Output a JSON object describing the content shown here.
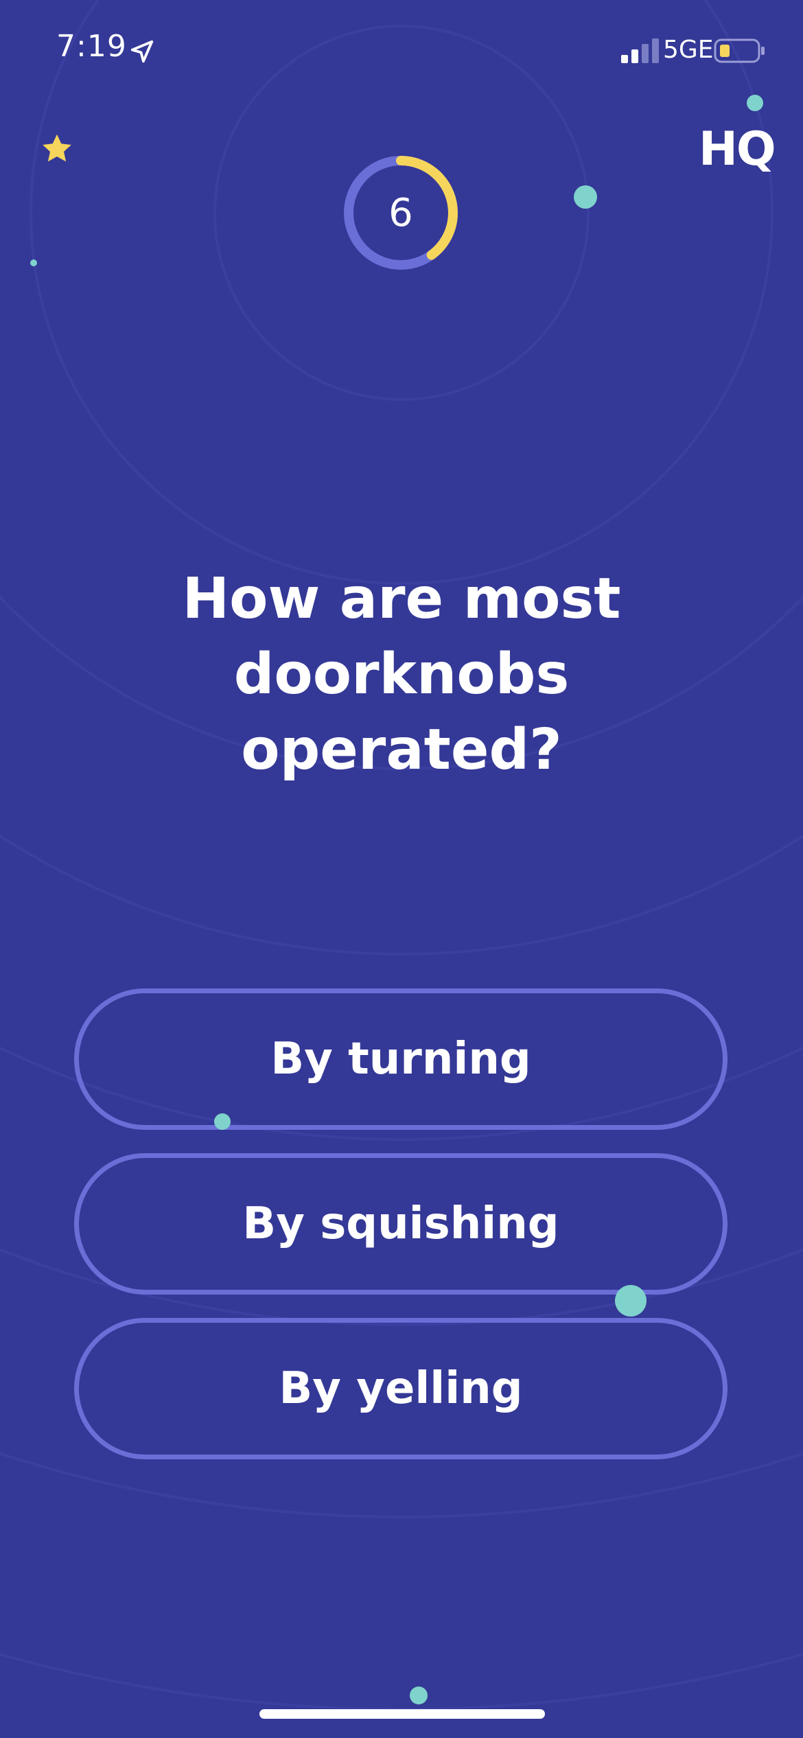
{
  "status_bar": {
    "time": "7:19",
    "network": "5GE",
    "location_icon": "location-arrow-icon",
    "signal_icon": "cellular-signal-icon",
    "battery_icon": "battery-low-icon"
  },
  "header": {
    "logo": "HQ",
    "star_icon": "star-icon"
  },
  "timer": {
    "seconds_left": "6",
    "progress_fraction": 0.4
  },
  "question": {
    "text": "How are most doorknobs operated?"
  },
  "answers": [
    {
      "label": "By turning"
    },
    {
      "label": "By squishing"
    },
    {
      "label": "By yelling"
    }
  ],
  "colors": {
    "background": "#343896",
    "button_border": "#6a6fd8",
    "timer_track": "#6a6fd8",
    "timer_progress": "#f6d55c",
    "star": "#f6d55c",
    "dots": "#7fd3cc"
  }
}
